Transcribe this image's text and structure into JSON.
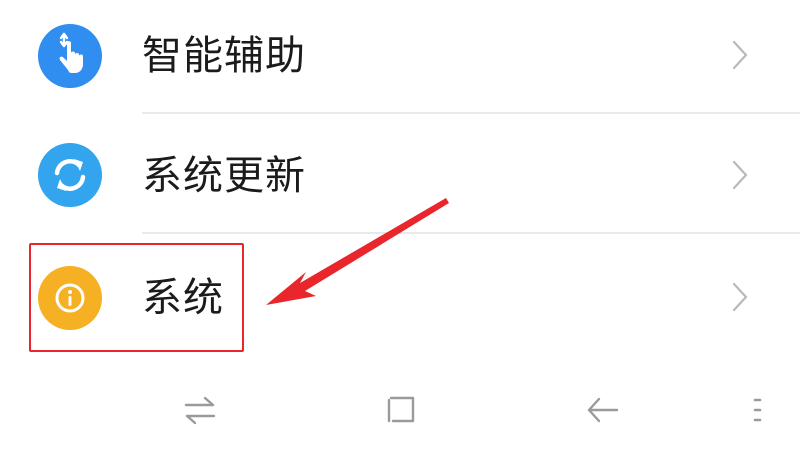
{
  "settings": {
    "items": [
      {
        "label": "智能辅助",
        "icon": "smart-assist-hand-icon",
        "icon_color": "#2f8ef0"
      },
      {
        "label": "系统更新",
        "icon": "system-update-refresh-icon",
        "icon_color": "#33a4ee"
      },
      {
        "label": "系统",
        "icon": "system-info-icon",
        "icon_color": "#f5b023"
      }
    ]
  },
  "annotation": {
    "color": "#e8262c",
    "highlighted_item": "系统"
  },
  "navbar": {
    "buttons": [
      "switch-apps-icon",
      "home-square-icon",
      "back-arrow-icon",
      "menu-icon"
    ],
    "icon_color": "#9a9a9a"
  }
}
